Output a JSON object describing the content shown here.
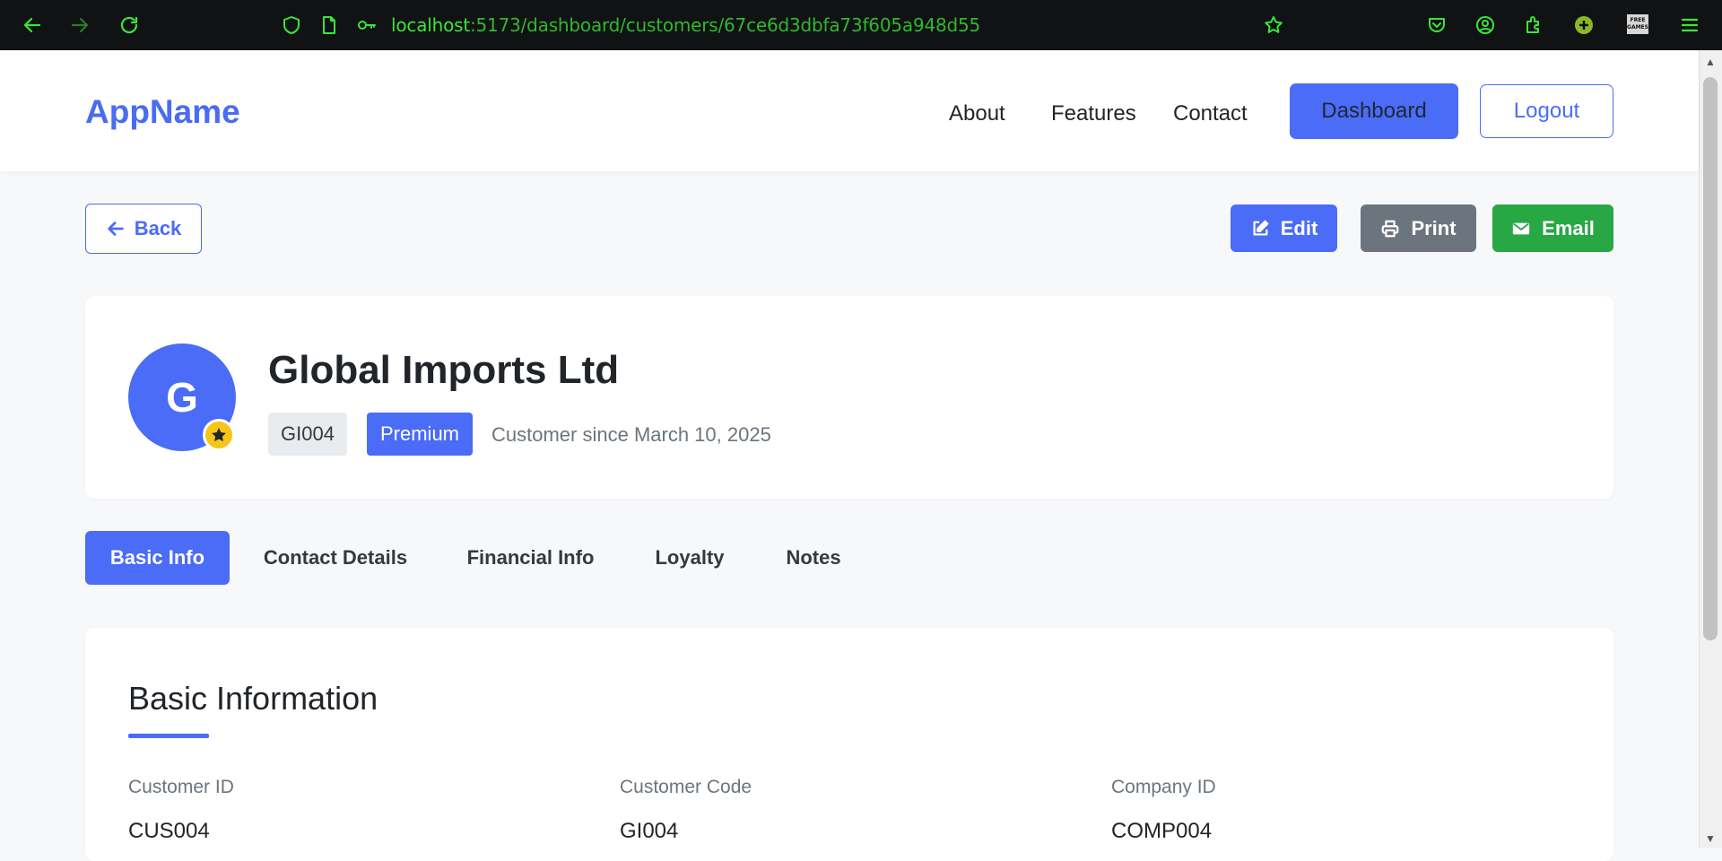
{
  "browser": {
    "url_host": "localhost",
    "url_path": ":5173/dashboard/customers/67ce6d3dbfa73f605a948d55",
    "free_games_label": "FREE GAMES"
  },
  "header": {
    "brand": "AppName",
    "nav": [
      "About",
      "Features",
      "Contact"
    ],
    "dashboard_label": "Dashboard",
    "logout_label": "Logout"
  },
  "actions": {
    "back_label": "Back",
    "edit_label": "Edit",
    "print_label": "Print",
    "email_label": "Email"
  },
  "customer": {
    "initial": "G",
    "name": "Global Imports Ltd",
    "code": "GI004",
    "tier": "Premium",
    "since": "Customer since March 10, 2025"
  },
  "tabs": [
    {
      "label": "Basic Info",
      "active": true
    },
    {
      "label": "Contact Details",
      "active": false
    },
    {
      "label": "Financial Info",
      "active": false
    },
    {
      "label": "Loyalty",
      "active": false
    },
    {
      "label": "Notes",
      "active": false
    }
  ],
  "basic_info": {
    "title": "Basic Information",
    "fields": [
      {
        "label": "Customer ID",
        "value": "CUS004"
      },
      {
        "label": "Customer Code",
        "value": "GI004"
      },
      {
        "label": "Company ID",
        "value": "COMP004"
      }
    ]
  },
  "colors": {
    "primary": "#4a6cf7",
    "secondary": "#6c757d",
    "success": "#28a745",
    "chrome_bg": "#111213",
    "chrome_icon": "#39e639"
  }
}
